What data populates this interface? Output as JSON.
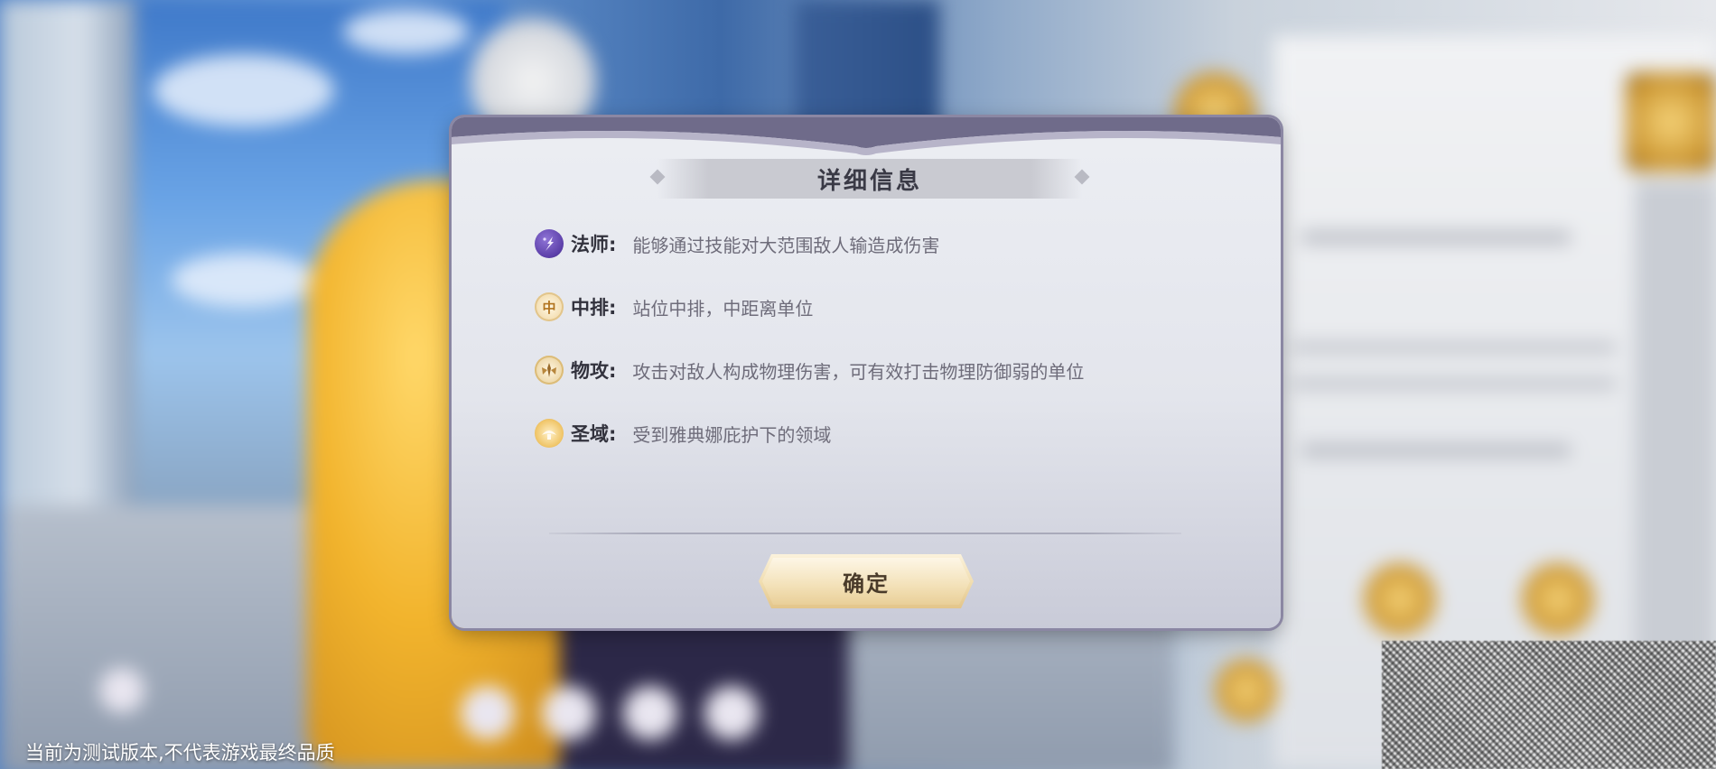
{
  "dialog": {
    "title": "详细信息",
    "items": [
      {
        "icon": "mage-class-icon",
        "label": "法师:",
        "desc": "能够通过技能对大范围敌人输造成伤害"
      },
      {
        "icon": "middle-row-icon",
        "label": "中排:",
        "desc": "站位中排，中距离单位"
      },
      {
        "icon": "physical-attack-icon",
        "label": "物攻:",
        "desc": "攻击对敌人构成物理伤害，可有效打击物理防御弱的单位"
      },
      {
        "icon": "sanctuary-icon",
        "label": "圣域:",
        "desc": "受到雅典娜庇护下的领域"
      }
    ],
    "confirm_label": "确定",
    "mid_icon_glyph": "中"
  },
  "footer": {
    "disclaimer": "当前为测试版本,不代表游戏最终品质"
  },
  "colors": {
    "dialog_border": "#8b87a3",
    "title_text": "#3a3a46",
    "desc_text": "#6e6c7a",
    "button_gold": "#e9cf98"
  }
}
